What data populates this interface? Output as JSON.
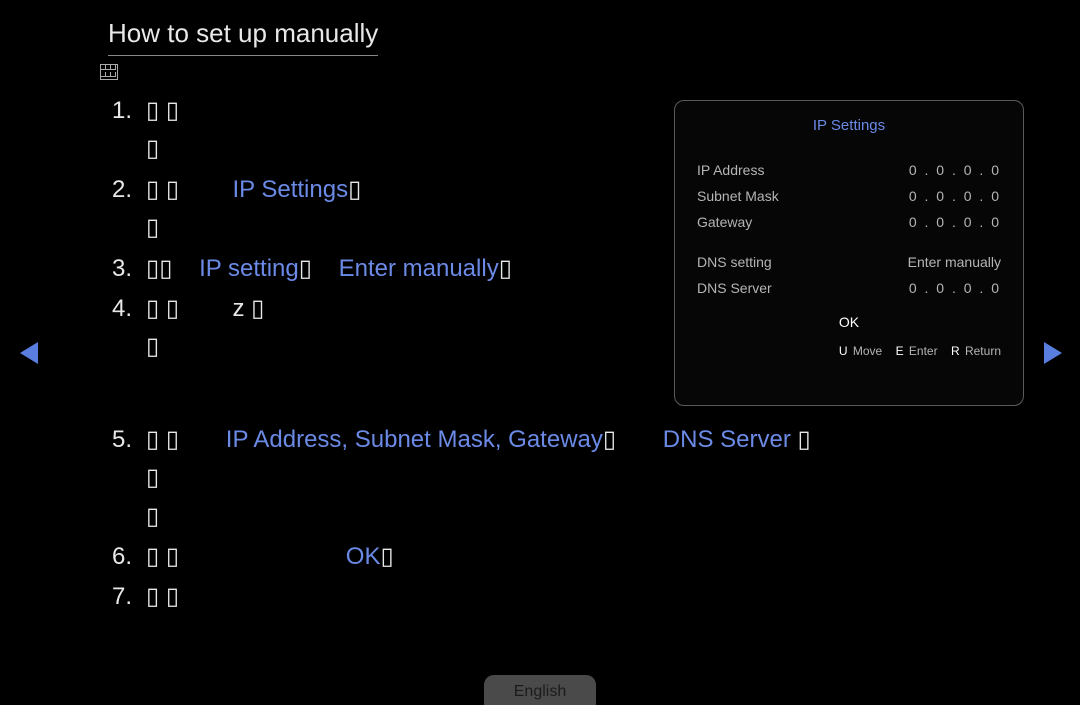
{
  "title": "How to set up manually",
  "steps": {
    "s1": {
      "num": "1.",
      "t1": "▯ ▯",
      "t2": "▯"
    },
    "s2": {
      "num": "2.",
      "t1": "▯ ▯",
      "hl": "IP Settings",
      "t2": "▯",
      "t3": "▯"
    },
    "s3": {
      "num": "3.",
      "t1": "▯▯",
      "hl1": "IP setting",
      "t2": "▯",
      "hl2": "Enter manually",
      "t3": "▯"
    },
    "s4": {
      "num": "4.",
      "t1": "▯ ▯",
      "mid": "z ▯",
      "t2": "▯"
    },
    "s5": {
      "num": "5.",
      "t1": "▯ ▯",
      "hl1": "IP Address, Subnet Mask, Gateway",
      "t2": "▯",
      "hl2": "DNS Server",
      "t3": " ▯",
      "t4": "▯",
      "t5": "▯"
    },
    "s6": {
      "num": "6.",
      "t1": "▯ ▯",
      "hl": "OK",
      "t2": "▯"
    },
    "s7": {
      "num": "7.",
      "t1": "▯ ▯"
    }
  },
  "panel": {
    "title": "IP Settings",
    "rows": {
      "ip": {
        "label": "IP Address",
        "value": "0 . 0 . 0 . 0"
      },
      "mask": {
        "label": "Subnet Mask",
        "value": "0 . 0 . 0 . 0"
      },
      "gw": {
        "label": "Gateway",
        "value": "0 . 0 . 0 . 0"
      },
      "dnsset": {
        "label": "DNS setting",
        "value": "Enter manually"
      },
      "dnssrv": {
        "label": "DNS Server",
        "value": "0 . 0 . 0 . 0"
      }
    },
    "ok": "OK",
    "footer": {
      "k1": "U",
      "v1": "Move",
      "k2": "E",
      "v2": "Enter",
      "k3": "R",
      "v3": "Return"
    }
  },
  "lang": "English"
}
